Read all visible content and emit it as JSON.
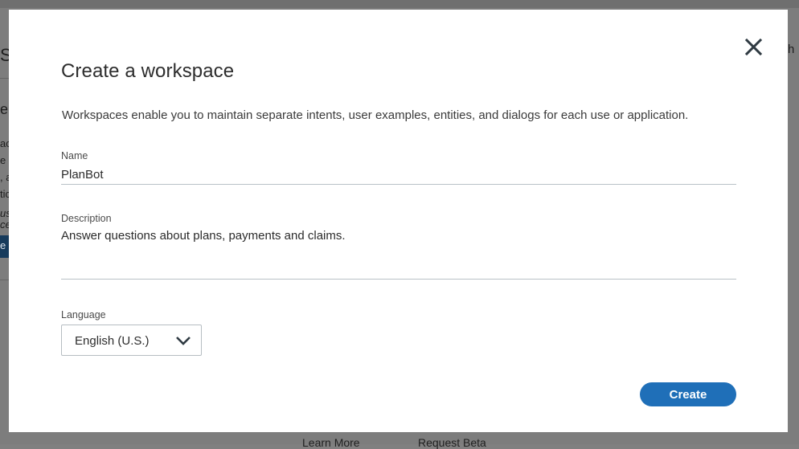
{
  "background": {
    "fragments": [
      "S",
      "e",
      "ac",
      "e",
      ", a",
      "tic",
      "us",
      "ce",
      "e",
      "h"
    ],
    "bottom_links": [
      "Learn More",
      "Request Beta"
    ]
  },
  "modal": {
    "title": "Create a workspace",
    "intro": "Workspaces enable you to maintain separate intents, user examples, entities, and dialogs for each use or application.",
    "close_icon": "close-icon",
    "name": {
      "label": "Name",
      "value": "PlanBot"
    },
    "description": {
      "label": "Description",
      "value": "Answer questions about plans, payments and claims."
    },
    "language": {
      "label": "Language",
      "value": "English (U.S.)",
      "icon": "chevron-down-icon"
    },
    "create_label": "Create"
  },
  "colors": {
    "primary": "#1f6fb8",
    "overlay": "#7d7d7d",
    "text": "#2d2d2d"
  }
}
